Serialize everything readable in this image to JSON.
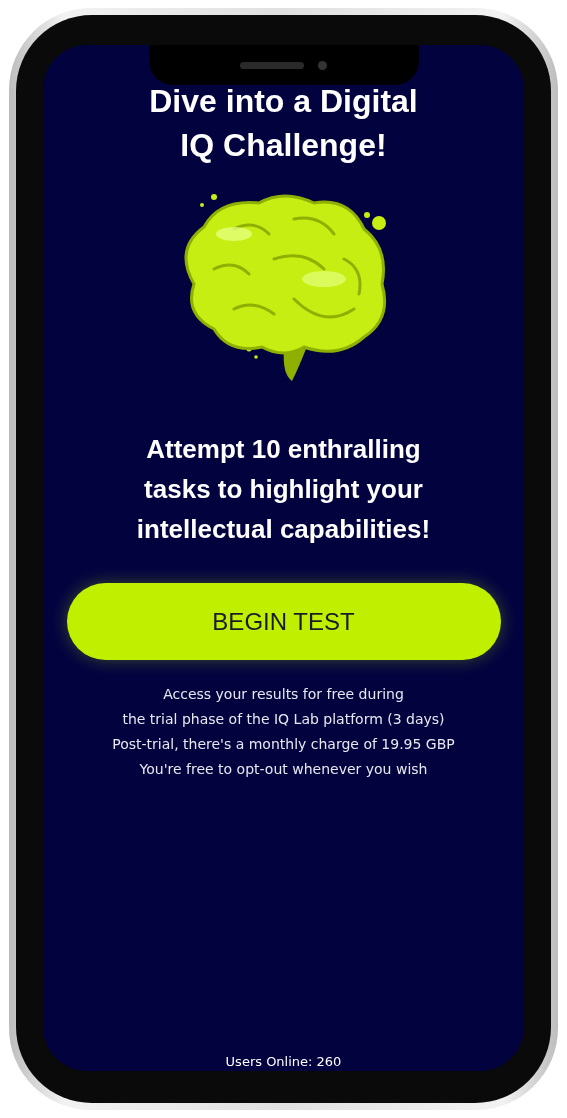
{
  "title_lines": [
    "Dive into a Digital",
    "IQ Challenge!"
  ],
  "subtitle_lines": [
    "Attempt 10 enthralling",
    "tasks to highlight your",
    "intellectual capabilities!"
  ],
  "cta_button": {
    "label": "BEGIN TEST"
  },
  "terms_lines": [
    "Access your results for free during",
    "the trial phase of the IQ Lab platform (3 days)",
    "Post-trial, there's a monthly charge of 19.95 GBP",
    "You're free to opt-out whenever you wish"
  ],
  "users_online": "Users Online: 260"
}
